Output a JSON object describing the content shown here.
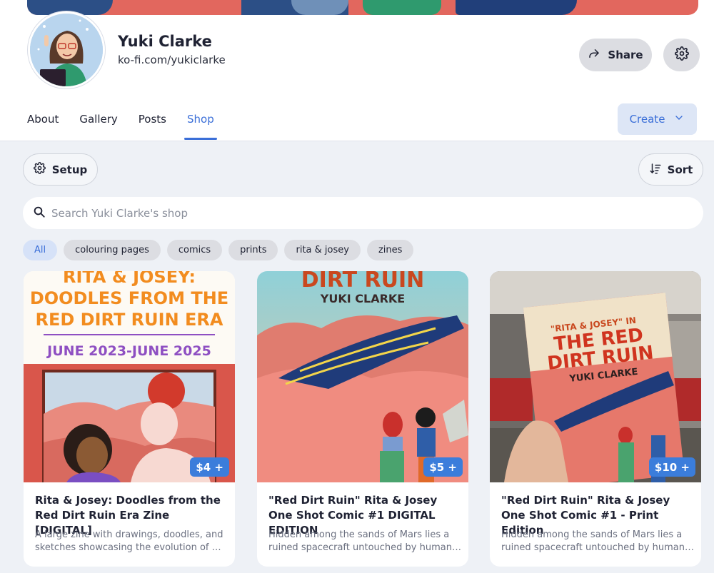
{
  "profile": {
    "name": "Yuki Clarke",
    "url": "ko-fi.com/yukiclarke",
    "share_label": "Share"
  },
  "tabs": [
    {
      "label": "About"
    },
    {
      "label": "Gallery"
    },
    {
      "label": "Posts"
    },
    {
      "label": "Shop",
      "active": true
    }
  ],
  "create_label": "Create",
  "shop": {
    "setup_label": "Setup",
    "sort_label": "Sort",
    "search_placeholder": "Search Yuki Clarke's shop",
    "filters": [
      {
        "label": "All",
        "active": true
      },
      {
        "label": "colouring pages"
      },
      {
        "label": "comics"
      },
      {
        "label": "prints"
      },
      {
        "label": "rita & josey"
      },
      {
        "label": "zines"
      }
    ],
    "products": [
      {
        "cover_lines": [
          "RITA & JOSEY:",
          "DOODLES FROM THE",
          "RED DIRT RUIN ERA",
          "JUNE 2023-JUNE 2025"
        ],
        "price": "$4 +",
        "title": "Rita & Josey: Doodles from the Red Dirt Ruin Era Zine [DIGITAL]",
        "description": "A large zine with drawings, doodles, and sketches showcasing the evolution of my art over the Red Dirt Ruin era."
      },
      {
        "cover_lines": [
          "DIRT RUIN",
          "YUKI CLARKE"
        ],
        "price": "$5 +",
        "title": "\"Red Dirt Ruin\" Rita & Josey One Shot Comic #1 DIGITAL EDITION",
        "description": "Hidden among the sands of Mars lies a ruined spacecraft untouched by human hands."
      },
      {
        "cover_lines": [
          "\"RITA & JOSEY\" IN",
          "THE RED",
          "DIRT RUIN",
          "YUKI CLARKE"
        ],
        "price": "$10 +",
        "title": "\"Red Dirt Ruin\" Rita & Josey One Shot Comic #1 - Print Edition",
        "description": "Hidden among the sands of Mars lies a ruined spacecraft untouched by human hands."
      }
    ]
  },
  "colors": {
    "accent": "#3b6fd8",
    "price_badge": "#3b7ddb",
    "shop_background": "#eef1f6"
  }
}
